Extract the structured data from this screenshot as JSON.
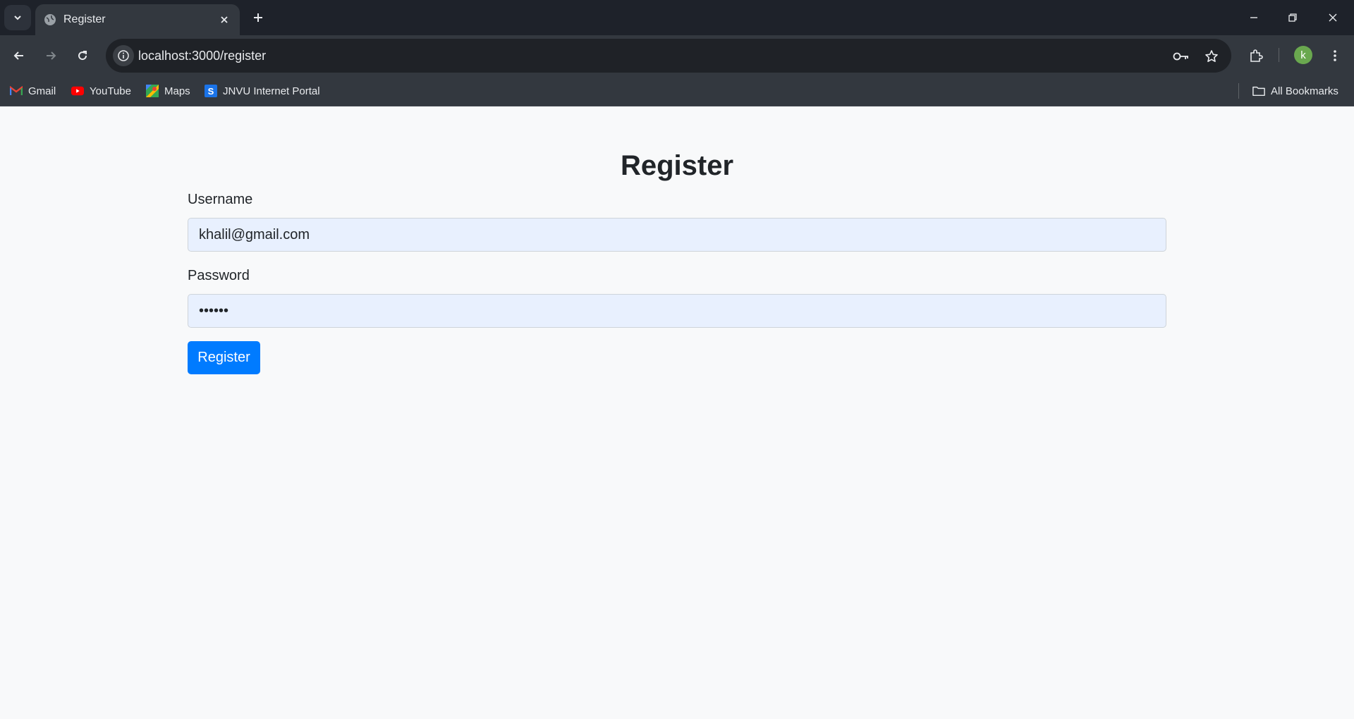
{
  "browser": {
    "tab": {
      "title": "Register",
      "favicon": "globe-icon"
    },
    "url": "localhost:3000/register",
    "profile_initial": "k",
    "bookmarks": [
      {
        "label": "Gmail",
        "icon": "gmail-icon"
      },
      {
        "label": "YouTube",
        "icon": "youtube-icon"
      },
      {
        "label": "Maps",
        "icon": "maps-icon"
      },
      {
        "label": "JNVU Internet Portal",
        "icon": "jnvu-icon"
      }
    ],
    "all_bookmarks_label": "All Bookmarks"
  },
  "form": {
    "heading": "Register",
    "username": {
      "label": "Username",
      "value": "khalil@gmail.com"
    },
    "password": {
      "label": "Password",
      "value": "••••••"
    },
    "submit_label": "Register"
  },
  "colors": {
    "primary_button": "#007bff",
    "autofill_bg": "#e8f0fe",
    "page_bg": "#f8f9fa",
    "chrome_dark": "#1e222a"
  }
}
